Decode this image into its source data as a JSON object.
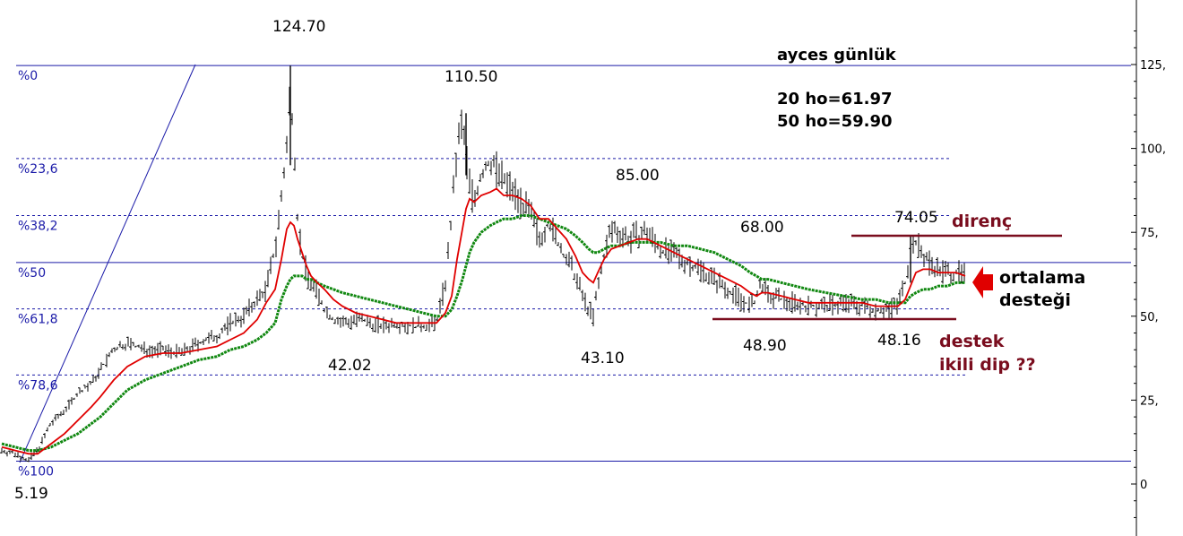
{
  "chart_data": {
    "type": "line",
    "title": "ayces günlük",
    "ma_lines": [
      "20 ho=61.97",
      "50 ho=59.90"
    ],
    "y_axis": {
      "ylim": [
        -12,
        140
      ],
      "ticks": [
        0,
        25,
        50,
        75,
        100,
        125
      ],
      "tick_labels": [
        "0",
        "25,",
        "50,",
        "75,",
        "100,",
        "125,"
      ]
    },
    "fib_levels": [
      {
        "label": "%0",
        "value": 124.7,
        "style": "solid"
      },
      {
        "label": "%23,6",
        "value": 97.0,
        "style": "dashed"
      },
      {
        "label": "%38,2",
        "value": 80.0,
        "style": "dashed"
      },
      {
        "label": "%50",
        "value": 66.0,
        "style": "solid"
      },
      {
        "label": "%61,8",
        "value": 52.2,
        "style": "dashed"
      },
      {
        "label": "%78,6",
        "value": 32.5,
        "style": "dashed"
      },
      {
        "label": "%100",
        "value": 6.8,
        "style": "solid"
      }
    ],
    "price_labels": [
      "124.70",
      "110.50",
      "85.00",
      "68.00",
      "74.05",
      "42.02",
      "43.10",
      "48.90",
      "48.16",
      "5.19"
    ],
    "annotations": {
      "resistance": "direnç",
      "support_1": "destek",
      "support_2": "ikili dip ??",
      "ma_support_1": "ortalama",
      "ma_support_2": "desteği"
    },
    "key_levels": {
      "resistance": 74.05,
      "support": 49.0
    },
    "colors": {
      "price": "#000000",
      "ma20": "#e00000",
      "ma50": "#118811",
      "fib": "#1a1aa8",
      "levels": "#7a0d1e",
      "arrow": "#e00000"
    },
    "x": [
      0,
      15,
      30,
      40,
      55,
      70,
      85,
      100,
      110,
      125,
      140,
      160,
      180,
      200,
      220,
      240,
      255,
      270,
      285,
      295,
      305,
      312,
      318,
      322,
      326,
      330,
      335,
      340,
      345,
      352,
      360,
      370,
      380,
      395,
      410,
      425,
      440,
      455,
      470,
      485,
      495,
      502,
      508,
      514,
      518,
      522,
      527,
      535,
      545,
      552,
      560,
      570,
      580,
      590,
      600,
      610,
      620,
      630,
      640,
      648,
      655,
      660,
      665,
      672,
      680,
      690,
      700,
      710,
      720,
      735,
      750,
      765,
      780,
      795,
      810,
      825,
      835,
      842,
      848,
      855,
      870,
      885,
      900,
      920,
      940,
      960,
      975,
      990,
      1000,
      1008,
      1014,
      1020,
      1028,
      1036,
      1045,
      1055,
      1065,
      1075
    ],
    "close": [
      10,
      9,
      7,
      10,
      18,
      22,
      27,
      30,
      34,
      40,
      42,
      40,
      40,
      39,
      42,
      44,
      48,
      50,
      55,
      58,
      70,
      85,
      100,
      118,
      103,
      80,
      68,
      63,
      60,
      57,
      52,
      49,
      48,
      49,
      48,
      47,
      48,
      47,
      47,
      48,
      60,
      80,
      100,
      108,
      98,
      90,
      84,
      92,
      96,
      94,
      90,
      88,
      84,
      80,
      73,
      78,
      72,
      67,
      62,
      56,
      52,
      50,
      58,
      68,
      76,
      75,
      73,
      74,
      75,
      70,
      68,
      66,
      64,
      61,
      58,
      55,
      53,
      55,
      60,
      56,
      55,
      54,
      53,
      53,
      54,
      53,
      52,
      52,
      54,
      60,
      70,
      72,
      68,
      66,
      64,
      63,
      63,
      62
    ],
    "ma20": [
      11,
      10,
      9,
      9,
      12,
      15,
      19,
      23,
      26,
      31,
      35,
      38,
      39,
      39,
      40,
      41,
      43,
      45,
      49,
      54,
      58,
      67,
      76,
      78,
      77,
      73,
      69,
      65,
      62,
      60,
      58,
      55,
      53,
      51,
      50,
      49,
      48,
      48,
      48,
      48,
      51,
      56,
      67,
      76,
      82,
      85,
      84,
      86,
      87,
      88,
      86,
      86,
      85,
      83,
      79,
      79,
      76,
      73,
      68,
      63,
      61,
      60,
      63,
      67,
      70,
      71,
      72,
      73,
      73,
      71,
      69,
      67,
      65,
      63,
      61,
      59,
      57,
      56,
      57,
      57,
      56,
      55,
      54,
      54,
      54,
      54,
      53,
      53,
      53,
      55,
      59,
      63,
      64,
      64,
      63,
      63,
      63,
      62
    ],
    "ma50": [
      12,
      11,
      10,
      10,
      11,
      13,
      15,
      18,
      20,
      24,
      28,
      31,
      33,
      35,
      37,
      38,
      40,
      41,
      43,
      45,
      48,
      55,
      59,
      61,
      62,
      62,
      62,
      61,
      61,
      60,
      59,
      58,
      57,
      56,
      55,
      54,
      53,
      52,
      51,
      50,
      50,
      52,
      56,
      61,
      65,
      69,
      72,
      75,
      77,
      78,
      79,
      79,
      80,
      80,
      79,
      78,
      77,
      76,
      74,
      72,
      70,
      69,
      69,
      70,
      71,
      71,
      72,
      72,
      72,
      72,
      71,
      71,
      70,
      69,
      67,
      65,
      63,
      62,
      61,
      61,
      60,
      59,
      58,
      57,
      56,
      55,
      55,
      54,
      54,
      54,
      56,
      57,
      58,
      58,
      59,
      59,
      60,
      60
    ]
  }
}
